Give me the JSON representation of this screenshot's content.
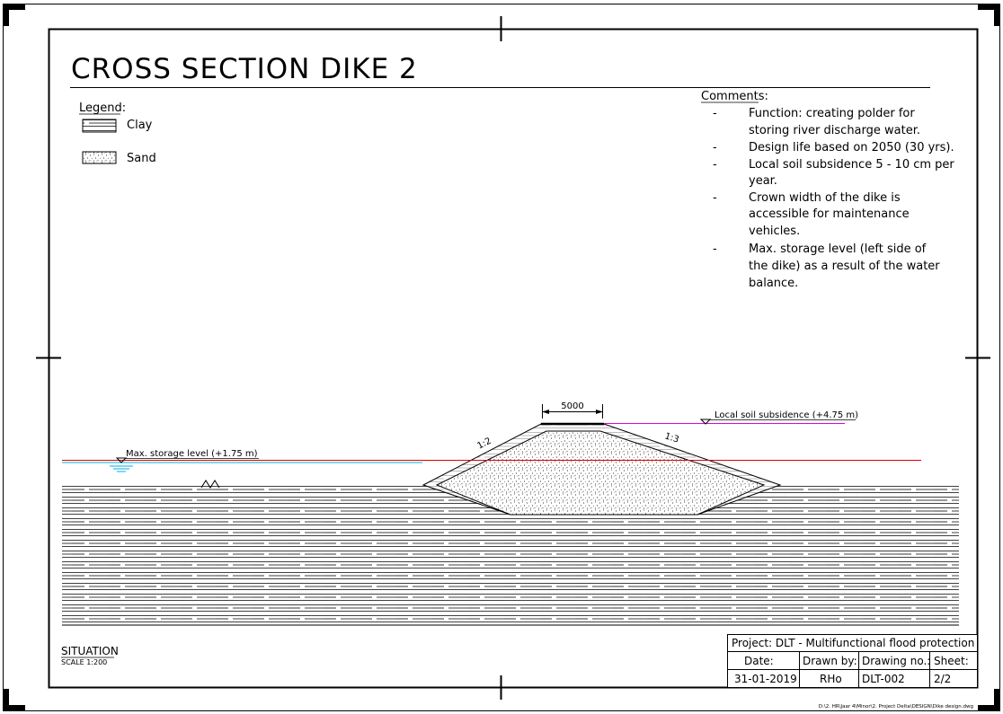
{
  "title": "CROSS SECTION DIKE 2",
  "legend": {
    "heading": "Legend:",
    "items": [
      {
        "label": "Clay",
        "pattern": "clay"
      },
      {
        "label": "Sand",
        "pattern": "sand"
      }
    ]
  },
  "comments": {
    "heading": "Comments:",
    "bullet": "-",
    "items": [
      [
        "Function: creating polder for",
        "storing river discharge water."
      ],
      [
        "Design life based on 2050 (30 yrs)."
      ],
      [
        "Local soil subsidence 5 - 10 cm per",
        "year."
      ],
      [
        "Crown width of the dike is",
        "accessible for maintenance",
        "vehicles."
      ],
      [
        "Max. storage level (left side of",
        "the dike) as a result of the water",
        "balance."
      ]
    ]
  },
  "section": {
    "crown_width": "5000",
    "slope_left": "1:2",
    "slope_right": "1:3",
    "max_storage_label": "Max. storage level (+1.75 m)",
    "subsidence_label": "Local soil subsidence (+4.75 m)"
  },
  "situation": {
    "label": "SITUATION",
    "scale": "SCALE 1:200"
  },
  "title_block": {
    "project": "Project: DLT - Multifunctional flood protection",
    "headers": [
      "Date:",
      "Drawn by:",
      "Drawing no.:",
      "Sheet:"
    ],
    "values": [
      "31-01-2019",
      "RHo",
      "DLT-002",
      "2/2"
    ]
  },
  "file_path": "D:\\2. HR\\Jaar 4\\Minor\\2. Project Delta\\DESIGN\\Dike design.dwg",
  "colors": {
    "water_level": "#e00000",
    "subsidence_line": "#e000e0",
    "water_symbol": "#00b0e0",
    "line": "#000000"
  }
}
